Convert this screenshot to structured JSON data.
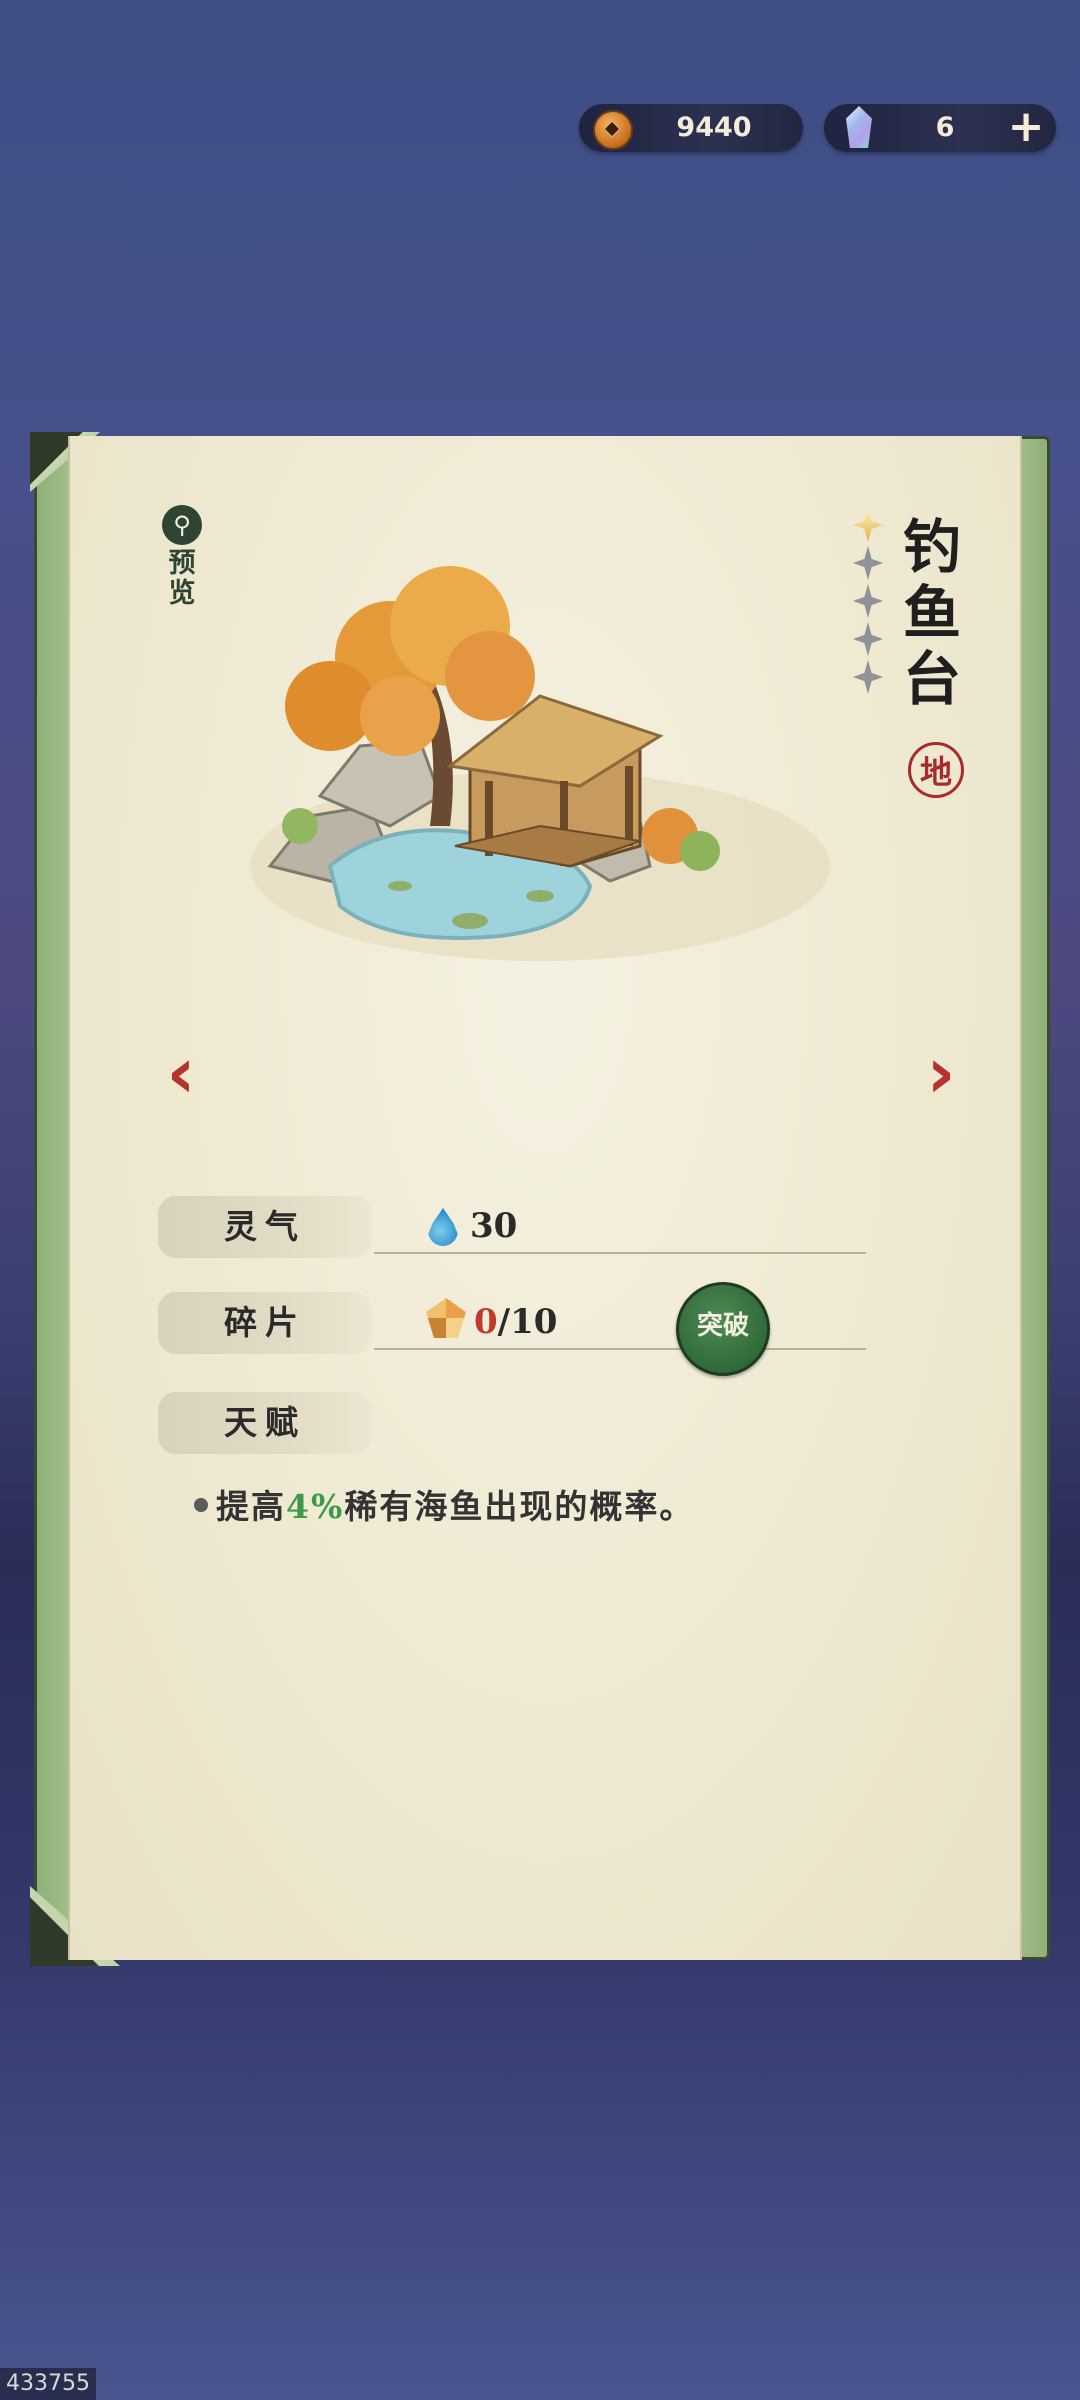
{
  "currency": {
    "coins": "9440",
    "gems": "6",
    "coin_icon": "copper-coin-icon",
    "gem_icon": "spirit-crystal-icon",
    "add_icon": "plus-icon"
  },
  "building": {
    "preview_icon": "zoom-icon",
    "preview_label": "预览",
    "name": "钓鱼台",
    "stars_total": 5,
    "stars_lit": 1,
    "rank": "地"
  },
  "stats": {
    "essence_label": "灵气",
    "essence_value": "30",
    "fragments_label": "碎片",
    "fragments_current": "0",
    "fragments_required": "/10",
    "breakthrough_label": "突破",
    "talent_label": "天赋",
    "talent_prefix": "提高",
    "talent_percent": "4%",
    "talent_suffix": "稀有海鱼出现的概率。"
  },
  "watermark": "433755",
  "colors": {
    "accent_green": "#2f6a3a",
    "arrow_red": "#b2342c",
    "seal_red": "#a82b2b",
    "talent_green": "#3e9a4a"
  }
}
